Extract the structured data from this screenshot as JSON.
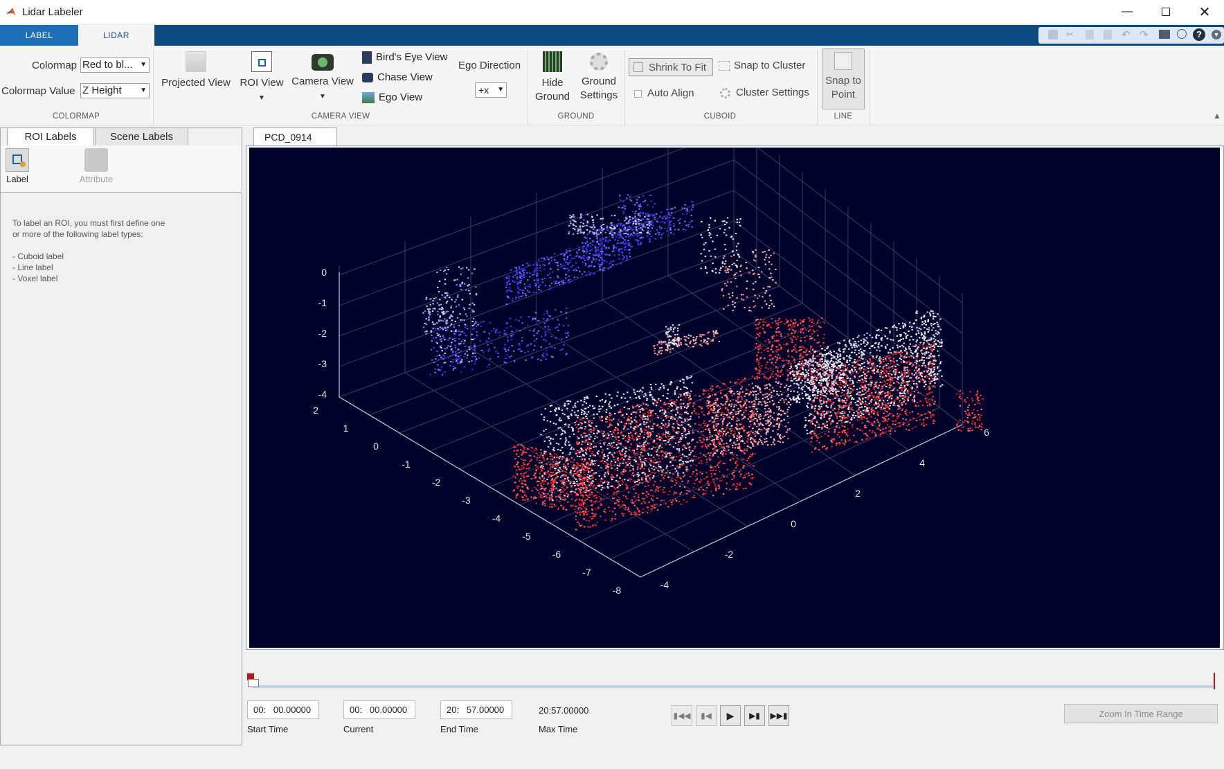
{
  "window": {
    "title": "Lidar Labeler"
  },
  "tabs": [
    {
      "label": "LABEL",
      "active": false
    },
    {
      "label": "LIDAR",
      "active": true
    }
  ],
  "ribbon": {
    "colormap": {
      "colormap_label": "Colormap",
      "colormap_value": "Red to bl...",
      "value_label": "Colormap Value",
      "value_value": "Z Height",
      "group_title": "COLORMAP"
    },
    "camera_view": {
      "projected_view": "Projected View",
      "roi_view": "ROI View",
      "camera_view": "Camera View",
      "birds_eye_view": "Bird's Eye View",
      "chase_view": "Chase View",
      "ego_view": "Ego View",
      "ego_direction_label": "Ego Direction",
      "ego_direction_value": "+x",
      "group_title": "CAMERA VIEW"
    },
    "ground": {
      "hide_ground_1": "Hide",
      "hide_ground_2": "Ground",
      "ground_settings_1": "Ground",
      "ground_settings_2": "Settings",
      "group_title": "GROUND"
    },
    "cuboid": {
      "shrink_to_fit": "Shrink To Fit",
      "snap_to_cluster": "Snap to Cluster",
      "auto_align": "Auto Align",
      "cluster_settings": "Cluster Settings",
      "group_title": "CUBOID"
    },
    "line": {
      "snap_1": "Snap to",
      "snap_2": "Point",
      "group_title": "LINE"
    }
  },
  "left_panel": {
    "tabs": [
      {
        "label": "ROI Labels"
      },
      {
        "label": "Scene Labels"
      }
    ],
    "label_button": "Label",
    "attribute_button": "Attribute",
    "help_line1": "To label an ROI, you must first define one",
    "help_line2": "or more of the following label types:",
    "items": [
      "- Cuboid label",
      "- Line label",
      "- Voxel label"
    ]
  },
  "main": {
    "tab_label": "PCD_0914",
    "z_ticks": [
      "0",
      "-1",
      "-2",
      "-3",
      "-4"
    ],
    "y_ticks": [
      "2",
      "1",
      "0",
      "-1",
      "-2",
      "-3",
      "-4",
      "-5",
      "-6",
      "-7",
      "-8"
    ],
    "x_ticks": [
      "-4",
      "-2",
      "0",
      "2",
      "4",
      "6"
    ]
  },
  "playback": {
    "start_time": "00:   00.00000",
    "current_time": "00:   00.00000",
    "end_time": "20:   57.00000",
    "max_time": "20:57.00000",
    "start_label": "Start Time",
    "current_label": "Current",
    "end_label": "End Time",
    "max_label": "Max Time",
    "zoom_button": "Zoom In Time Range"
  }
}
